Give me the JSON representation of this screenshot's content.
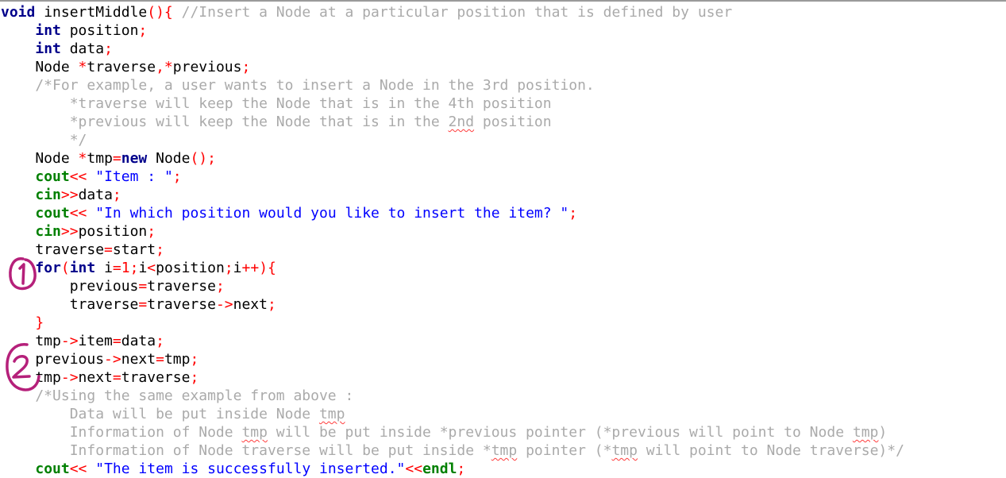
{
  "theme": {
    "background": "#ffffff",
    "keyword": "#00008b",
    "stream": "#008000",
    "operator": "#ff0000",
    "string": "#0000ff",
    "comment": "#aaaaaa",
    "annotation": "#b5207a"
  },
  "code": {
    "lines": [
      [
        {
          "t": "void",
          "c": "kw"
        },
        {
          "t": " insertMiddle",
          "c": "id"
        },
        {
          "t": "(){",
          "c": "op"
        },
        {
          "t": " //Insert a Node at a particular position that is defined by user",
          "c": "cm"
        }
      ],
      [
        {
          "t": "    "
        },
        {
          "t": "int",
          "c": "kw"
        },
        {
          "t": " position",
          "c": "id"
        },
        {
          "t": ";",
          "c": "op"
        }
      ],
      [
        {
          "t": "    "
        },
        {
          "t": "int",
          "c": "kw"
        },
        {
          "t": " data",
          "c": "id"
        },
        {
          "t": ";",
          "c": "op"
        }
      ],
      [
        {
          "t": "    Node ",
          "c": "id"
        },
        {
          "t": "*",
          "c": "op"
        },
        {
          "t": "traverse",
          "c": "id"
        },
        {
          "t": ",*",
          "c": "op"
        },
        {
          "t": "previous",
          "c": "id"
        },
        {
          "t": ";",
          "c": "op"
        }
      ],
      [
        {
          "t": "    /*For example, a user wants to insert a Node in the 3rd position.",
          "c": "cm"
        }
      ],
      [
        {
          "t": "        *traverse will keep the Node that is in the 4th position",
          "c": "cm"
        }
      ],
      [
        {
          "t": "        *previous will keep the Node that is in the ",
          "c": "cm"
        },
        {
          "t": "2nd",
          "c": "cm",
          "u": true
        },
        {
          "t": " position",
          "c": "cm"
        }
      ],
      [
        {
          "t": "        */",
          "c": "cm"
        }
      ],
      [
        {
          "t": "    Node ",
          "c": "id"
        },
        {
          "t": "*",
          "c": "op"
        },
        {
          "t": "tmp",
          "c": "id"
        },
        {
          "t": "=",
          "c": "op"
        },
        {
          "t": "new",
          "c": "kw"
        },
        {
          "t": " Node",
          "c": "id"
        },
        {
          "t": "();",
          "c": "op"
        }
      ],
      [
        {
          "t": "    "
        },
        {
          "t": "cout",
          "c": "io"
        },
        {
          "t": "<<",
          "c": "op"
        },
        {
          "t": " \"Item : \"",
          "c": "str"
        },
        {
          "t": ";",
          "c": "op"
        }
      ],
      [
        {
          "t": "    "
        },
        {
          "t": "cin",
          "c": "io"
        },
        {
          "t": ">>",
          "c": "op"
        },
        {
          "t": "data",
          "c": "id"
        },
        {
          "t": ";",
          "c": "op"
        }
      ],
      [
        {
          "t": "    "
        },
        {
          "t": "cout",
          "c": "io"
        },
        {
          "t": "<<",
          "c": "op"
        },
        {
          "t": " \"In which position would you like to insert the item? \"",
          "c": "str"
        },
        {
          "t": ";",
          "c": "op"
        }
      ],
      [
        {
          "t": "    "
        },
        {
          "t": "cin",
          "c": "io"
        },
        {
          "t": ">>",
          "c": "op"
        },
        {
          "t": "position",
          "c": "id"
        },
        {
          "t": ";",
          "c": "op"
        }
      ],
      [
        {
          "t": "    traverse",
          "c": "id"
        },
        {
          "t": "=",
          "c": "op"
        },
        {
          "t": "start",
          "c": "id"
        },
        {
          "t": ";",
          "c": "op"
        }
      ],
      [
        {
          "t": "    "
        },
        {
          "t": "for",
          "c": "kw"
        },
        {
          "t": "(",
          "c": "op"
        },
        {
          "t": "int",
          "c": "kw"
        },
        {
          "t": " i",
          "c": "id"
        },
        {
          "t": "=1;",
          "c": "op"
        },
        {
          "t": "i",
          "c": "id"
        },
        {
          "t": "<",
          "c": "op"
        },
        {
          "t": "position",
          "c": "id"
        },
        {
          "t": ";",
          "c": "op"
        },
        {
          "t": "i",
          "c": "id"
        },
        {
          "t": "++){",
          "c": "op"
        }
      ],
      [
        {
          "t": "        previous",
          "c": "id"
        },
        {
          "t": "=",
          "c": "op"
        },
        {
          "t": "traverse",
          "c": "id"
        },
        {
          "t": ";",
          "c": "op"
        }
      ],
      [
        {
          "t": "        traverse",
          "c": "id"
        },
        {
          "t": "=",
          "c": "op"
        },
        {
          "t": "traverse",
          "c": "id"
        },
        {
          "t": "->",
          "c": "op"
        },
        {
          "t": "next",
          "c": "id"
        },
        {
          "t": ";",
          "c": "op"
        }
      ],
      [
        {
          "t": "    "
        },
        {
          "t": "}",
          "c": "op"
        }
      ],
      [
        {
          "t": "    tmp",
          "c": "id"
        },
        {
          "t": "->",
          "c": "op"
        },
        {
          "t": "item",
          "c": "id"
        },
        {
          "t": "=",
          "c": "op"
        },
        {
          "t": "data",
          "c": "id"
        },
        {
          "t": ";",
          "c": "op"
        }
      ],
      [
        {
          "t": "    previous",
          "c": "id"
        },
        {
          "t": "->",
          "c": "op"
        },
        {
          "t": "next",
          "c": "id"
        },
        {
          "t": "=",
          "c": "op"
        },
        {
          "t": "tmp",
          "c": "id"
        },
        {
          "t": ";",
          "c": "op"
        }
      ],
      [
        {
          "t": "    tmp",
          "c": "id"
        },
        {
          "t": "->",
          "c": "op"
        },
        {
          "t": "next",
          "c": "id"
        },
        {
          "t": "=",
          "c": "op"
        },
        {
          "t": "traverse",
          "c": "id"
        },
        {
          "t": ";",
          "c": "op"
        }
      ],
      [
        {
          "t": "    /*Using the same example from above :",
          "c": "cm"
        }
      ],
      [
        {
          "t": "        Data will be put inside Node ",
          "c": "cm"
        },
        {
          "t": "tmp",
          "c": "cm",
          "u": true
        }
      ],
      [
        {
          "t": "        Information of Node ",
          "c": "cm"
        },
        {
          "t": "tmp",
          "c": "cm",
          "u": true
        },
        {
          "t": " will be put inside *previous pointer (*previous will point to Node ",
          "c": "cm"
        },
        {
          "t": "tmp",
          "c": "cm",
          "u": true
        },
        {
          "t": ")",
          "c": "cm"
        }
      ],
      [
        {
          "t": "        Information of Node traverse will be put inside *",
          "c": "cm"
        },
        {
          "t": "tmp",
          "c": "cm",
          "u": true
        },
        {
          "t": " pointer (*",
          "c": "cm"
        },
        {
          "t": "tmp",
          "c": "cm",
          "u": true
        },
        {
          "t": " will point to Node traverse)*/",
          "c": "cm"
        }
      ],
      [
        {
          "t": "    "
        },
        {
          "t": "cout",
          "c": "io"
        },
        {
          "t": "<<",
          "c": "op"
        },
        {
          "t": " \"The item is successfully inserted.\"",
          "c": "str"
        },
        {
          "t": "<<",
          "c": "op"
        },
        {
          "t": "endl",
          "c": "io"
        },
        {
          "t": ";",
          "c": "op"
        }
      ]
    ]
  },
  "annotations": [
    {
      "label": "1",
      "name": "annotation-marker-1"
    },
    {
      "label": "2",
      "name": "annotation-marker-2"
    }
  ]
}
